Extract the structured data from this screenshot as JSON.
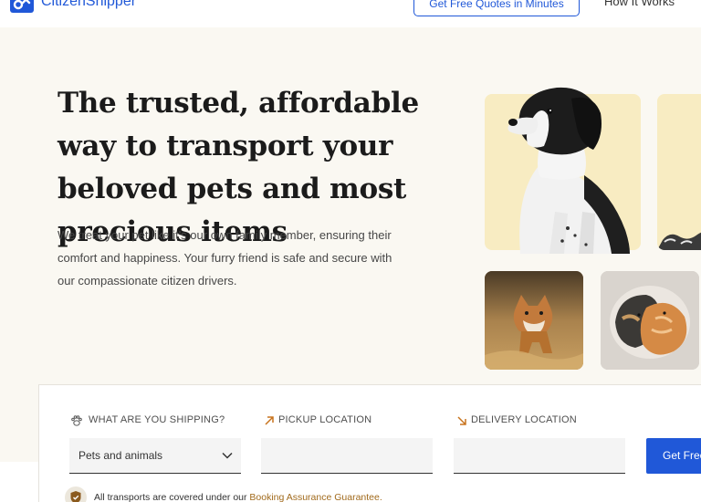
{
  "header": {
    "logo_text": "CitizenShipper",
    "cta_label": "Get Free Quotes in Minutes",
    "nav_how_it_works": "How It Works"
  },
  "hero": {
    "title": "The trusted, affordable way to transport your beloved pets and most precious items",
    "description": "We treat your pet like it's our own family member, ensuring their comfort and happiness. Your furry friend is safe and secure with our compassionate citizen drivers."
  },
  "form": {
    "shipping_label": "WHAT ARE YOU SHIPPING?",
    "shipping_value": "Pets and animals",
    "pickup_label": "PICKUP LOCATION",
    "pickup_value": "",
    "delivery_label": "DELIVERY LOCATION",
    "delivery_value": "",
    "submit_label": "Get Free Quotes",
    "assurance_prefix": "All transports are covered under our ",
    "assurance_link": "Booking Assurance Guarantee."
  },
  "icons": {
    "logo": "logo-icon",
    "paw": "paw-icon",
    "pickup": "arrow-up-right-icon",
    "delivery": "arrow-down-right-icon",
    "chevron": "chevron-down-icon",
    "shield": "shield-icon"
  },
  "colors": {
    "brand_blue": "#2058d8",
    "hero_background": "#faf8f2",
    "tile_yellow": "#f8ecc2",
    "link_gold": "#a16a1c",
    "arrow_orange": "#c8741e"
  }
}
